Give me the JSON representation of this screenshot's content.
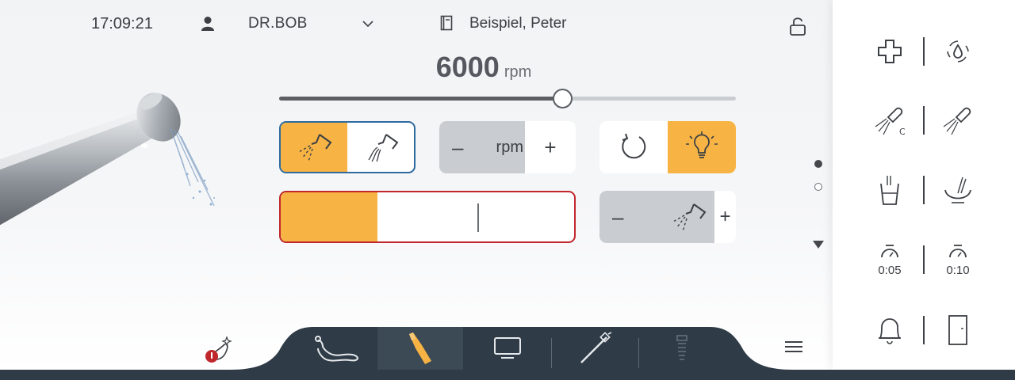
{
  "header": {
    "clock": "17:09:21",
    "user_name": "DR.BOB",
    "patient_name": "Beispiel, Peter"
  },
  "instrument": {
    "speed_value": "6000",
    "speed_unit": "rpm",
    "speed_slider_fraction": 0.62,
    "program_fill_fraction": 0.33
  },
  "controls": {
    "rpm_label": "rpm",
    "minus_glyph": "–",
    "plus_glyph": "+"
  },
  "quick_actions": {
    "timer_short": "0:05",
    "timer_long": "0:10"
  },
  "pager": {
    "pages": 2,
    "active_page": 1
  },
  "colors": {
    "accent": "#f7b445",
    "selection_border": "#2f6a9e",
    "alert_border": "#c0272d",
    "tabbar": "#2f3b47",
    "tab_active": "#3c4a56",
    "badge": "#c0272d",
    "text": "#3c3f44"
  },
  "icons": {
    "header": [
      "user-icon",
      "chevron-down-icon",
      "patient-card-icon",
      "unlock-icon"
    ],
    "instrument": [
      "spray-icon",
      "spray-chip-icon",
      "rotation-direction-icon",
      "light-bulb-icon",
      "water-spray-icon"
    ],
    "tabs": [
      "dental-chair-icon",
      "instrument-icon",
      "monitor-icon",
      "scaler-icon",
      "implant-icon"
    ],
    "right_panel": [
      "cross-icon",
      "water-drop-icon",
      "handpiece-clean-icon",
      "handpiece-flush-icon",
      "cup-fill-icon",
      "bowl-rinse-icon",
      "timer-icon",
      "timer-icon",
      "bell-icon",
      "door-icon"
    ]
  }
}
